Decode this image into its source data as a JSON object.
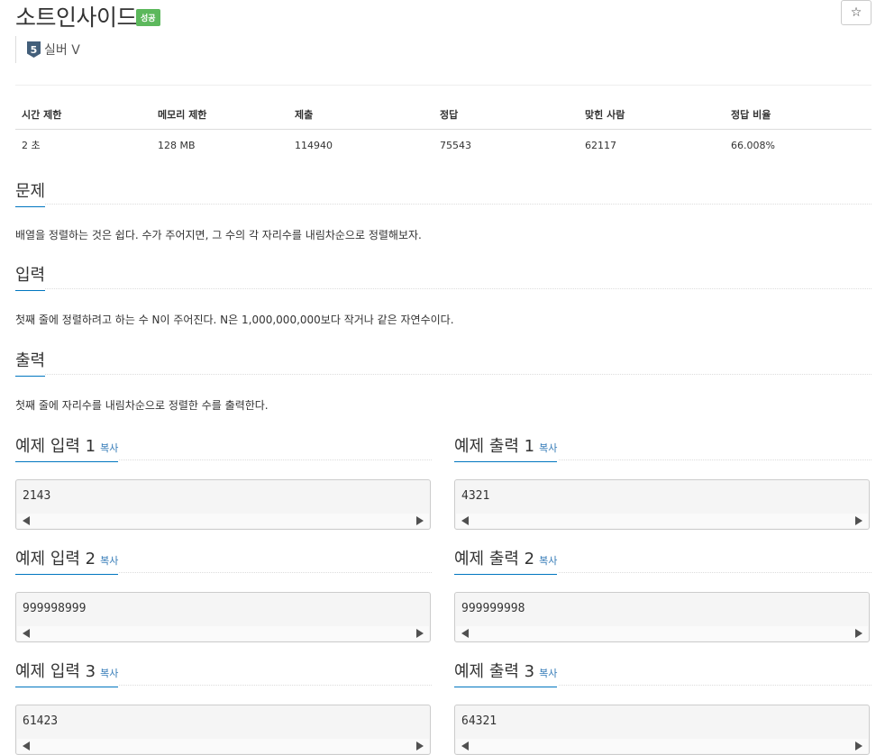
{
  "problem": {
    "title": "소트인사이드",
    "status_badge": "성공",
    "star_icon": "☆",
    "tier": {
      "number": "5",
      "label": "실버 V"
    }
  },
  "info_table": {
    "headers": [
      "시간 제한",
      "메모리 제한",
      "제출",
      "정답",
      "맞힌 사람",
      "정답 비율"
    ],
    "values": [
      "2 초",
      "128 MB",
      "114940",
      "75543",
      "62117",
      "66.008%"
    ]
  },
  "sections": {
    "description": {
      "heading": "문제",
      "text": "배열을 정렬하는 것은 쉽다. 수가 주어지면, 그 수의 각 자리수를 내림차순으로 정렬해보자."
    },
    "input": {
      "heading": "입력",
      "text": "첫째 줄에 정렬하려고 하는 수 N이 주어진다. N은 1,000,000,000보다 작거나 같은 자연수이다."
    },
    "output": {
      "heading": "출력",
      "text": "첫째 줄에 자리수를 내림차순으로 정렬한 수를 출력한다."
    }
  },
  "copy_label": "복사",
  "examples": [
    {
      "input_label": "예제 입력 1",
      "input": "2143",
      "output_label": "예제 출력 1",
      "output": "4321"
    },
    {
      "input_label": "예제 입력 2",
      "input": "999998999",
      "output_label": "예제 출력 2",
      "output": "999999998"
    },
    {
      "input_label": "예제 입력 3",
      "input": "61423",
      "output_label": "예제 출력 3",
      "output": "64321"
    }
  ],
  "colors": {
    "accent": "#0076c0",
    "success": "#5cb85c",
    "tier": "#435f7a",
    "link": "#337ab7"
  }
}
